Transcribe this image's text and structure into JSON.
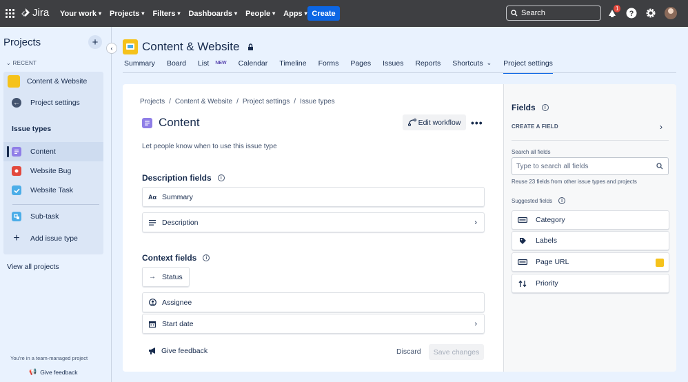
{
  "topnav": {
    "logo_text": "Jira",
    "menu": [
      {
        "label": "Your work"
      },
      {
        "label": "Projects"
      },
      {
        "label": "Filters"
      },
      {
        "label": "Dashboards"
      },
      {
        "label": "People"
      },
      {
        "label": "Apps"
      }
    ],
    "create_label": "Create",
    "search_placeholder": "Search",
    "notification_count": "1"
  },
  "sidebar": {
    "title": "Projects",
    "recent_label": "RECENT",
    "project_name": "Content & Website",
    "project_settings_label": "Project settings",
    "issue_types_header": "Issue types",
    "issue_types": [
      {
        "label": "Content",
        "color": "#8f7ee7"
      },
      {
        "label": "Website Bug",
        "color": "#e2483d"
      },
      {
        "label": "Website Task",
        "color": "#4bade8"
      }
    ],
    "subtask_label": "Sub-task",
    "add_issue_type_label": "Add issue type",
    "view_all_label": "View all projects",
    "team_managed_note": "You're in a team-managed project",
    "feedback_label": "Give feedback"
  },
  "project": {
    "name": "Content & Website",
    "tabs": [
      {
        "label": "Summary"
      },
      {
        "label": "Board"
      },
      {
        "label": "List",
        "badge": "NEW"
      },
      {
        "label": "Calendar"
      },
      {
        "label": "Timeline"
      },
      {
        "label": "Forms"
      },
      {
        "label": "Pages"
      },
      {
        "label": "Issues"
      },
      {
        "label": "Reports"
      },
      {
        "label": "Shortcuts"
      },
      {
        "label": "Project settings"
      }
    ]
  },
  "main": {
    "breadcrumbs": [
      "Projects",
      "Content & Website",
      "Project settings",
      "Issue types"
    ],
    "issue_type_title": "Content",
    "edit_workflow_label": "Edit workflow",
    "description_placeholder": "Let people know when to use this issue type",
    "description_fields_title": "Description fields",
    "description_fields": [
      "Summary",
      "Description"
    ],
    "context_fields_title": "Context fields",
    "status_label": "Status",
    "context_fields": [
      "Assignee",
      "Start date"
    ],
    "give_feedback_label": "Give feedback",
    "discard_label": "Discard",
    "save_label": "Save changes"
  },
  "fields_panel": {
    "title": "Fields",
    "create_field_label": "CREATE A FIELD",
    "search_label": "Search all fields",
    "search_placeholder": "Type to search all fields",
    "reuse_note": "Reuse 23 fields from other issue types and projects",
    "suggested_label": "Suggested fields",
    "suggested": [
      "Category",
      "Labels",
      "Page URL",
      "Priority"
    ]
  },
  "colors": {
    "topnav_bg": "#3e3f42",
    "accent": "#0c66e4",
    "page_bg": "#e9f2fe",
    "project_avatar": "#f5c21b"
  }
}
